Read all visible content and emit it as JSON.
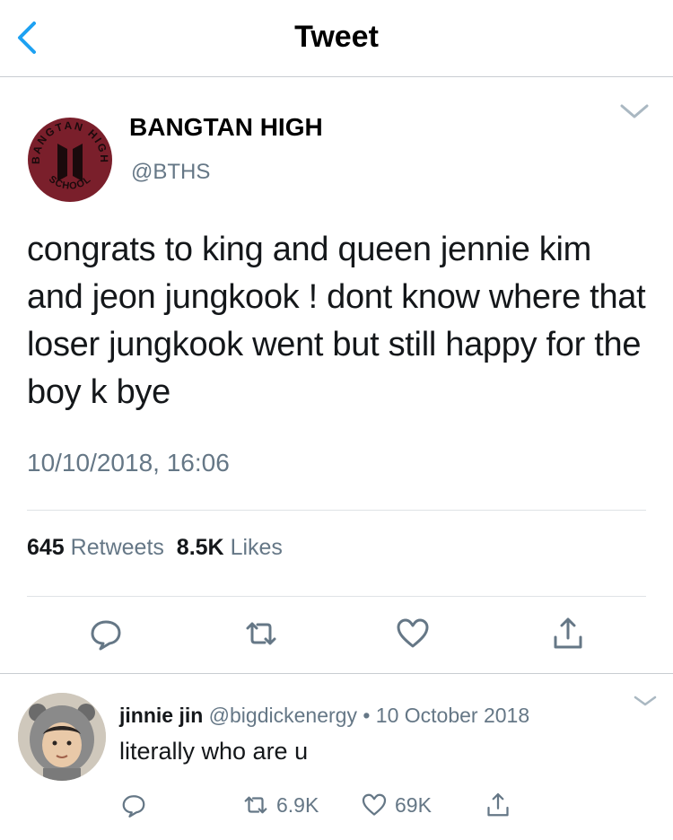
{
  "navbar": {
    "title": "Tweet",
    "back_icon": "chevron-left-icon"
  },
  "tweet": {
    "display_name": "BANGTAN HIGH",
    "handle": "@BTHS",
    "logo": {
      "top_text": "BANGTAN HIGH",
      "bottom_text": "SCHOOL",
      "color": "#7a1f2b"
    },
    "text": "congrats to king and queen jennie kim and jeon jungkook ! dont know where that loser jungkook went but still happy for the boy k bye",
    "timestamp": "10/10/2018, 16:06",
    "retweet_count": "645",
    "retweets_label": "Retweets",
    "like_count": "8.5K",
    "likes_label": "Likes",
    "actions": [
      "reply-icon",
      "retweet-icon",
      "like-icon",
      "share-icon"
    ]
  },
  "reply": {
    "display_name": "jinnie jin",
    "handle": "@bigdickenergy",
    "separator": "•",
    "date": "10 October 2018",
    "text": "literally who are u",
    "retweet_count": "6.9K",
    "like_count": "69K"
  },
  "colors": {
    "accent": "#1da1f2",
    "muted": "#657786",
    "text": "#14171a",
    "divider": "#dfe3e6"
  }
}
